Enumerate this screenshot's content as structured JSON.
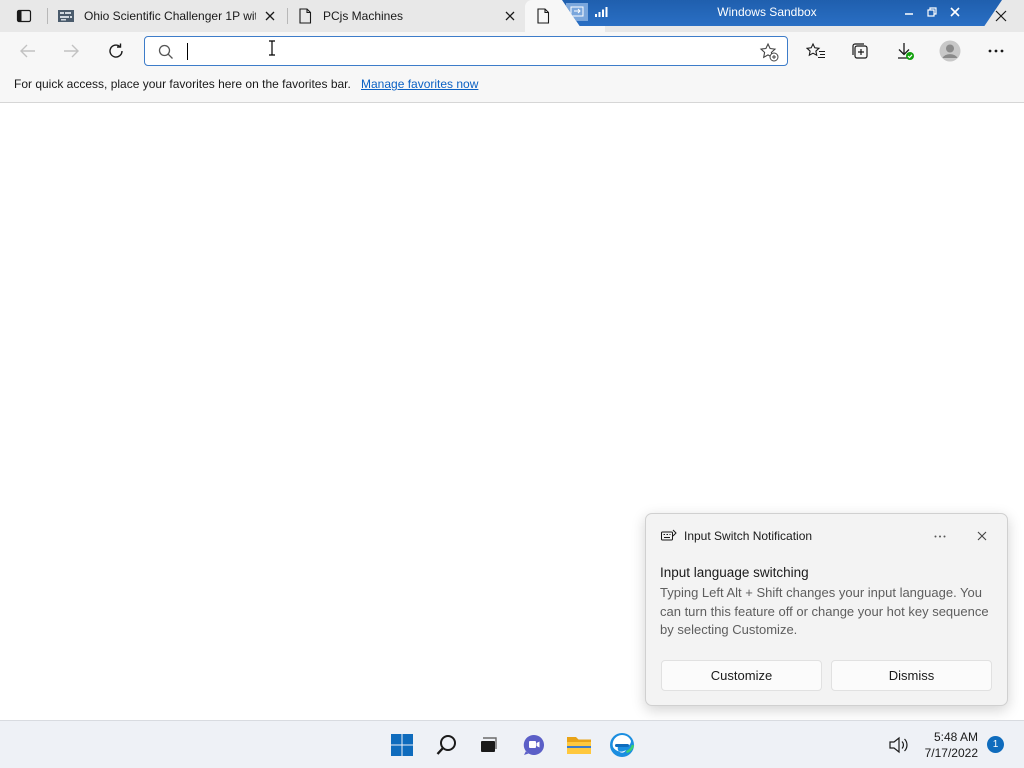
{
  "tabs": [
    {
      "title": "Ohio Scientific Challenger 1P wit",
      "favicon": "osi-favicon-icon"
    },
    {
      "title": "PCjs Machines",
      "favicon": "page-icon"
    },
    {
      "title": "",
      "favicon": "page-icon"
    }
  ],
  "sandbox": {
    "title": "Windows Sandbox"
  },
  "address_bar": {
    "value": "",
    "placeholder": ""
  },
  "favorites_bar": {
    "message": "For quick access, place your favorites here on the favorites bar.",
    "link": "Manage favorites now"
  },
  "notification": {
    "app": "Input Switch Notification",
    "heading": "Input language switching",
    "body": "Typing Left Alt + Shift changes your input language. You can turn this feature off or change your hot key sequence by selecting Customize.",
    "buttons": {
      "customize": "Customize",
      "dismiss": "Dismiss"
    }
  },
  "taskbar": {
    "apps": [
      "start-icon",
      "search-icon",
      "task-view-icon",
      "teams-chat-icon",
      "file-explorer-icon",
      "edge-icon"
    ],
    "time": "5:48 AM",
    "date": "7/17/2022",
    "notification_count": "1"
  },
  "colors": {
    "accent": "#0f6cbd",
    "sandbox_bar": "#1f5fae",
    "link": "#0b61c4"
  }
}
